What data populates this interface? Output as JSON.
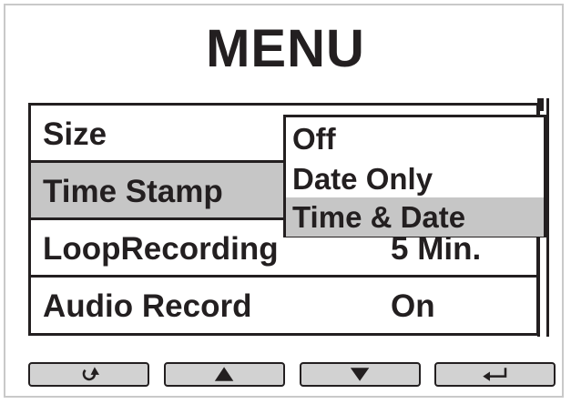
{
  "title": "MENU",
  "menu": {
    "items": [
      {
        "label": "Size",
        "value": ""
      },
      {
        "label": "Time Stamp",
        "value": ""
      },
      {
        "label": "LoopRecording",
        "value": "5 Min."
      },
      {
        "label": "Audio Record",
        "value": "On"
      }
    ],
    "selected_index": 1
  },
  "dropdown": {
    "options": [
      "Off",
      "Date Only",
      "Time & Date"
    ],
    "active_index": 2
  },
  "buttons": [
    {
      "icon": "back-arrow-icon"
    },
    {
      "icon": "up-arrow-icon"
    },
    {
      "icon": "down-arrow-icon"
    },
    {
      "icon": "enter-icon"
    }
  ],
  "colors": {
    "ink": "#231f20",
    "highlight": "#c6c6c6",
    "button_fill": "#d2d2d2",
    "frame": "#c9c9c9"
  }
}
